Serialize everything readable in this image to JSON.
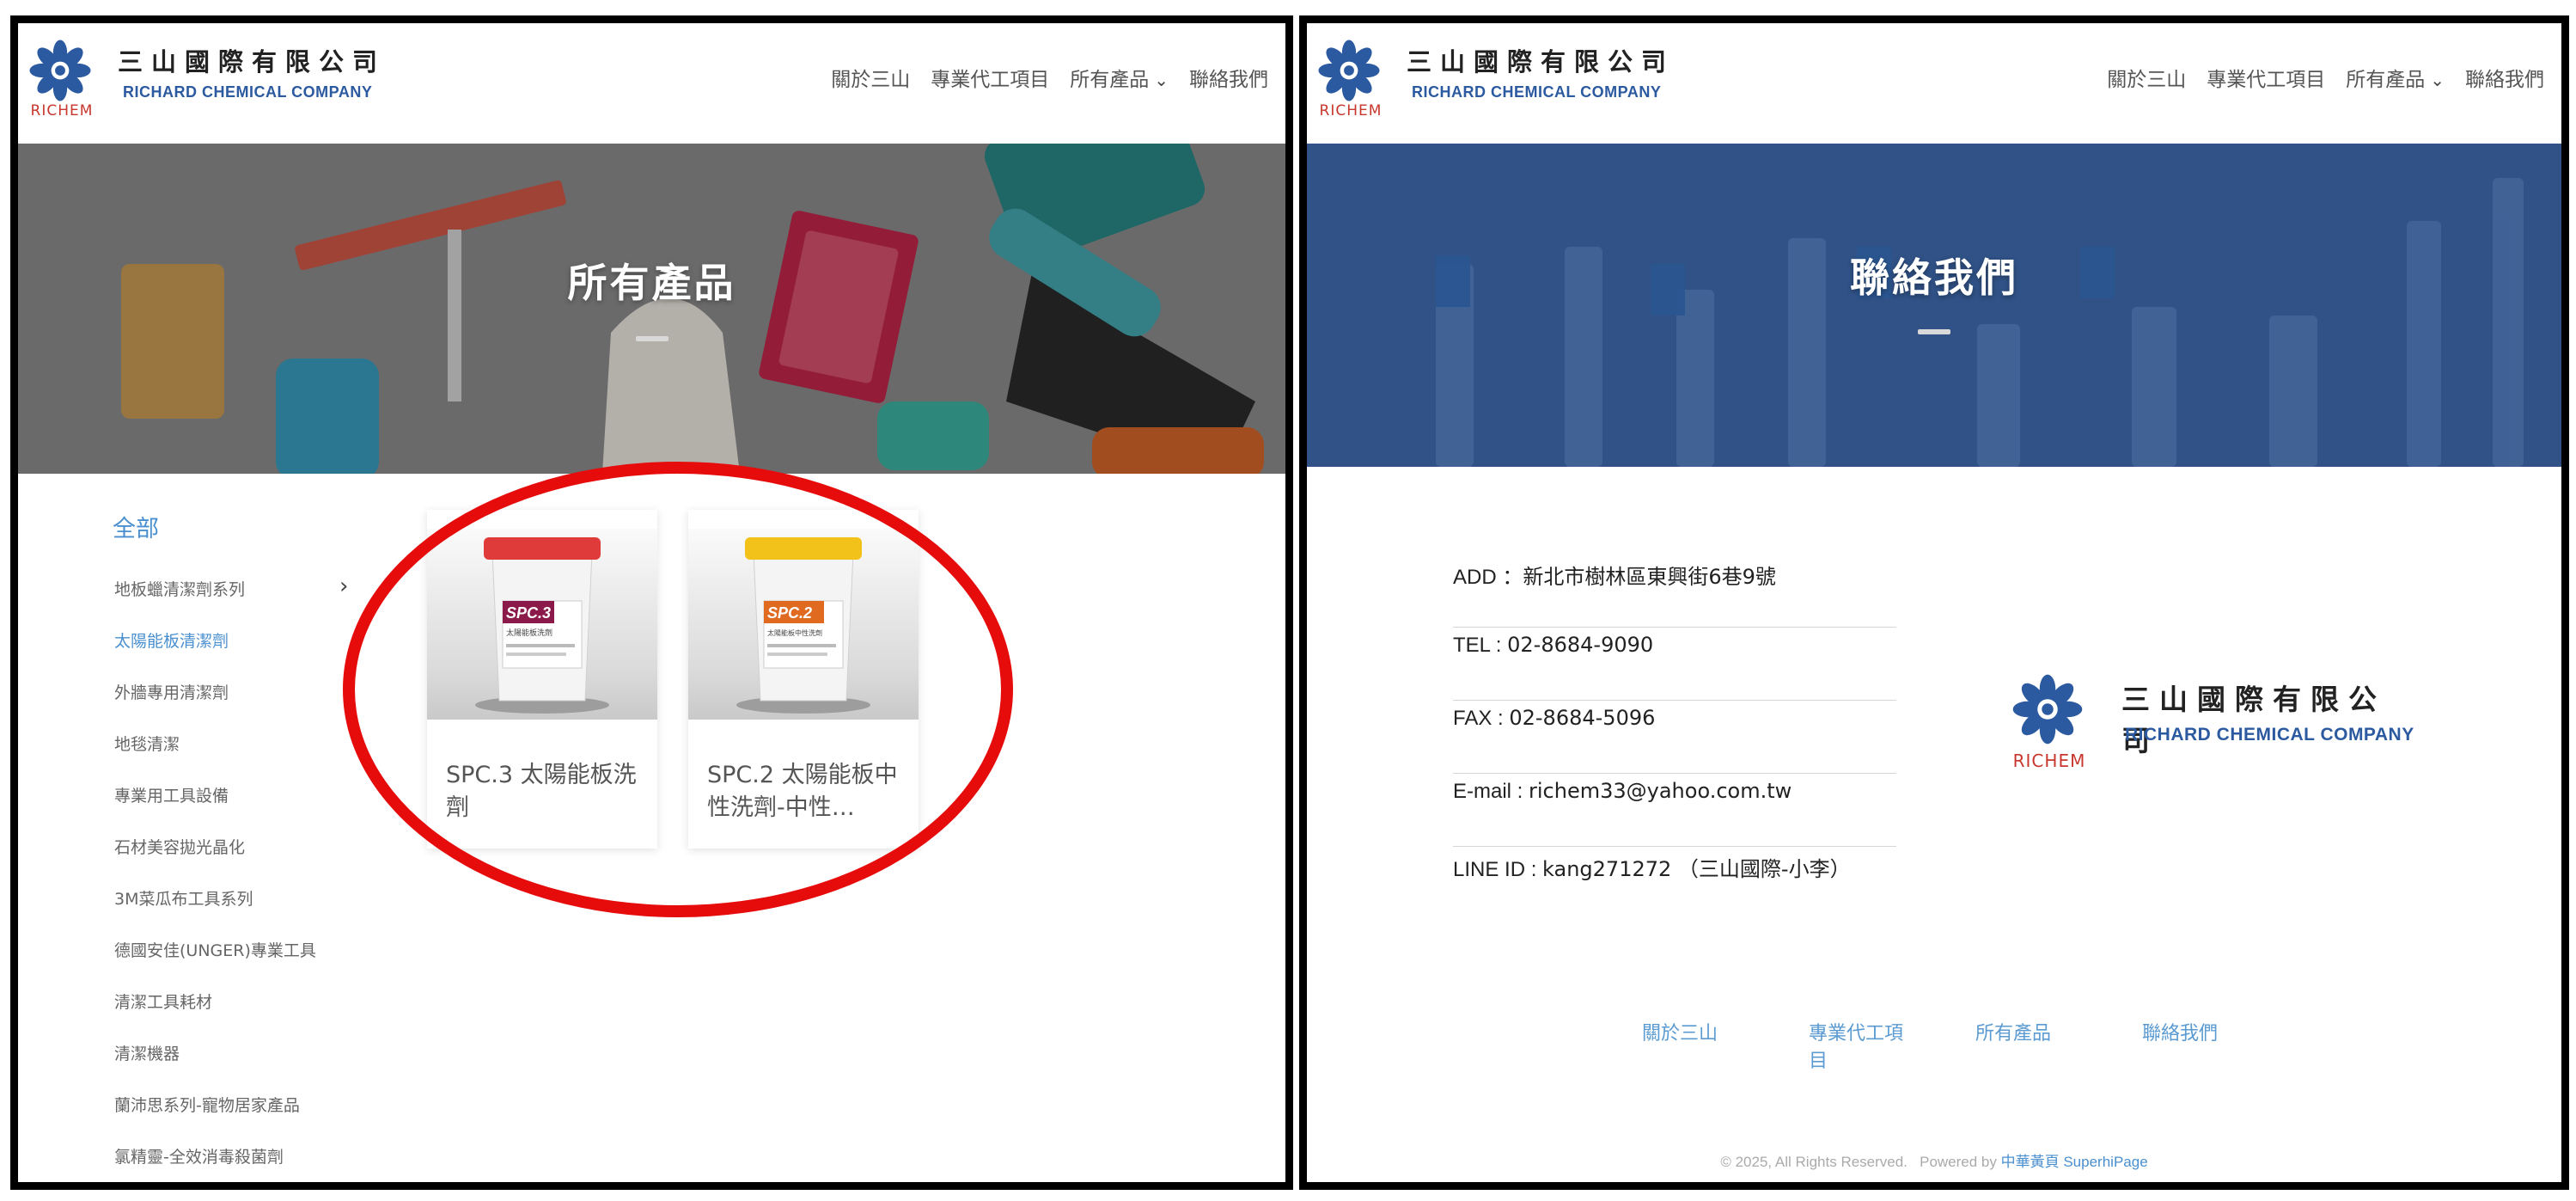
{
  "brand": {
    "name_cn": "三山國際有限公司",
    "name_en": "RICHARD CHEMICAL COMPANY",
    "logo_text": "RICHEM",
    "logo_color": "#2c5aa0",
    "accent_color": "#4a8fcf"
  },
  "nav": {
    "items": [
      {
        "label": "關於三山"
      },
      {
        "label": "專業代工項目"
      },
      {
        "label": "所有產品",
        "has_dropdown": true
      },
      {
        "label": "聯絡我們"
      }
    ]
  },
  "products_page": {
    "banner_title": "所有產品",
    "category_all": "全部",
    "categories": [
      {
        "label": "地板蠟清潔劑系列",
        "has_submenu": true
      },
      {
        "label": "太陽能板清潔劑",
        "active": true
      },
      {
        "label": "外牆專用清潔劑"
      },
      {
        "label": "地毯清潔"
      },
      {
        "label": "專業用工具設備"
      },
      {
        "label": "石材美容拋光晶化"
      },
      {
        "label": "3M菜瓜布工具系列"
      },
      {
        "label": "德國安佳(UNGER)專業工具"
      },
      {
        "label": "清潔工具耗材"
      },
      {
        "label": "清潔機器"
      },
      {
        "label": "蘭沛思系列-寵物居家產品"
      },
      {
        "label": "氯精靈-全效消毒殺菌劑"
      }
    ],
    "products": [
      {
        "name": "SPC.3 太陽能板洗劑",
        "label_text": "SPC.3",
        "label_sub": "太陽能板洗劑",
        "lid_color": "#e03b3b",
        "label_color": "#8b1a4a"
      },
      {
        "name": "SPC.2 太陽能板中性洗劑-中性…",
        "label_text": "SPC.2",
        "label_sub": "太陽能板中性洗劑",
        "lid_color": "#f2c21b",
        "label_color": "#e06a1f"
      }
    ],
    "highlight_color": "#e60c0c"
  },
  "contact_page": {
    "banner_title": "聯絡我們",
    "rows": [
      {
        "label": "ADD ：",
        "value": "新北市樹林區東興街6巷9號"
      },
      {
        "label": "TEL : ",
        "value": "02-8684-9090"
      },
      {
        "label": "FAX : ",
        "value": "02-8684-5096"
      },
      {
        "label": "E-mail : ",
        "value": "richem33@yahoo.com.tw"
      },
      {
        "label": "LINE ID : ",
        "value": "kang271272 （三山國際-小李）"
      }
    ],
    "footer_links": [
      {
        "label": "關於三山"
      },
      {
        "label": "專業代工項目"
      },
      {
        "label": "所有產品"
      },
      {
        "label": "聯絡我們"
      }
    ],
    "copyright": "© 2025, All Rights Reserved.",
    "powered_by_prefix": "Powered by",
    "powered_by": "中華黃頁 SuperhiPage"
  }
}
